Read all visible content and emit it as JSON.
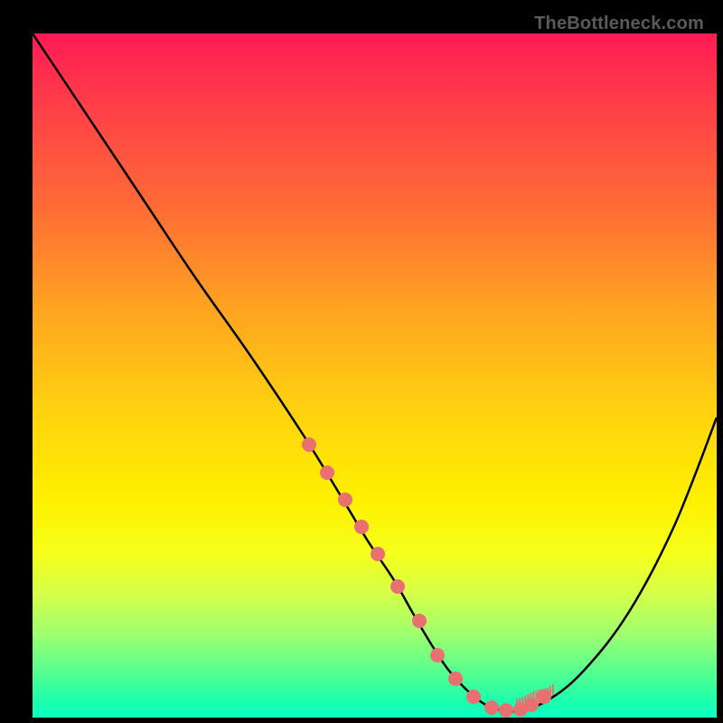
{
  "watermark": "TheBottleneck.com",
  "chart_data": {
    "type": "line",
    "title": "",
    "xlabel": "",
    "ylabel": "",
    "xlim": [
      0,
      757
    ],
    "ylim": [
      0,
      757
    ],
    "series": [
      {
        "name": "bottleneck-curve",
        "x": [
          0,
          60,
          120,
          180,
          240,
          300,
          340,
          370,
          400,
          420,
          440,
          460,
          480,
          500,
          520,
          540,
          570,
          610,
          660,
          710,
          757
        ],
        "y_top": [
          0,
          90,
          180,
          270,
          355,
          445,
          510,
          560,
          605,
          640,
          674,
          704,
          726,
          742,
          749,
          749,
          738,
          705,
          640,
          545,
          425
        ],
        "stroke": "#000000",
        "width": 2.5
      }
    ],
    "markers": {
      "name": "salmon-dots",
      "color": "#e97070",
      "radius": 8,
      "points_x": [
        306,
        326,
        346,
        364,
        382,
        404,
        428,
        448,
        468,
        488,
        508,
        524,
        540,
        552,
        566
      ],
      "points_y_top": [
        455,
        486,
        516,
        546,
        576,
        612,
        650,
        688,
        714,
        734,
        746,
        749,
        748,
        743,
        734
      ]
    },
    "ticks": {
      "name": "salmon-ticks",
      "color": "#e97070",
      "width": 2,
      "length_min": 6,
      "length_max": 16,
      "x_start": 536,
      "x_end": 576,
      "count": 14
    },
    "background_gradient": {
      "stops": [
        {
          "pos": 0.0,
          "color": "#ff1a55"
        },
        {
          "pos": 0.25,
          "color": "#ff6a36"
        },
        {
          "pos": 0.55,
          "color": "#ffd210"
        },
        {
          "pos": 0.76,
          "color": "#f6ff1a"
        },
        {
          "pos": 0.92,
          "color": "#6cff8a"
        },
        {
          "pos": 1.0,
          "color": "#0affc0"
        }
      ]
    }
  }
}
